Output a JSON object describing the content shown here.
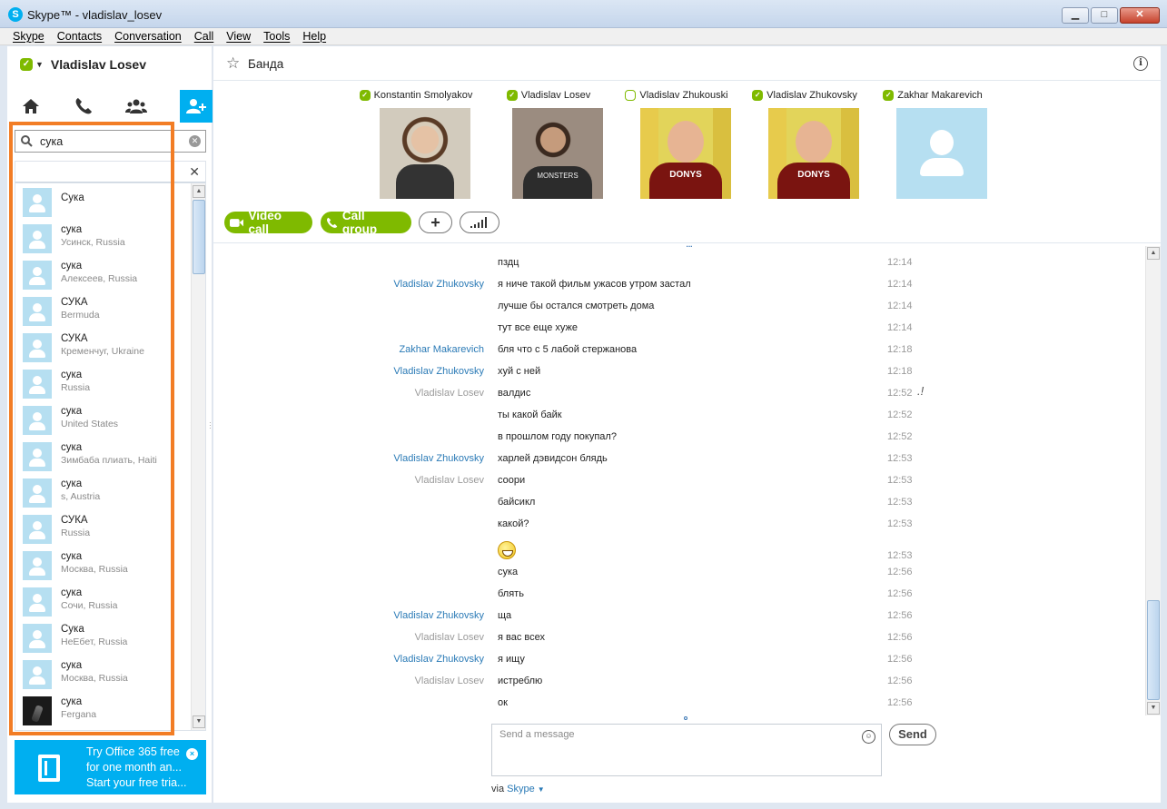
{
  "window": {
    "title": "Skype™ - vladislav_losev",
    "app_icon": "S",
    "minimize": "▁",
    "maximize": "□",
    "close": "✕"
  },
  "menu": [
    "Skype",
    "Contacts",
    "Conversation",
    "Call",
    "View",
    "Tools",
    "Help"
  ],
  "profile": {
    "name": "Vladislav Losev",
    "status_icon": "online-check-icon"
  },
  "nav_tabs": [
    "home-icon",
    "call-icon",
    "contacts-icon",
    "add-contact-icon"
  ],
  "search": {
    "value": "сука",
    "clear_icon": "clear-icon"
  },
  "results_header": {
    "close": "✕"
  },
  "results": [
    {
      "name": "Сука",
      "location": ""
    },
    {
      "name": "сука",
      "location": "Усинск, Russia"
    },
    {
      "name": "сука",
      "location": "Алексеев, Russia"
    },
    {
      "name": "СУКА",
      "location": "Bermuda"
    },
    {
      "name": "СУКА",
      "location": "Кременчуг, Ukraine"
    },
    {
      "name": "сука",
      "location": "Russia"
    },
    {
      "name": "сука",
      "location": "United States"
    },
    {
      "name": "сука",
      "location": "Зимбаба плиать, Haiti"
    },
    {
      "name": "сука",
      "location": "s, Austria"
    },
    {
      "name": "СУКА",
      "location": "Russia"
    },
    {
      "name": "сука",
      "location": "Москва, Russia"
    },
    {
      "name": "сука",
      "location": "Сочи, Russia"
    },
    {
      "name": "Сука",
      "location": "НеЕбет, Russia"
    },
    {
      "name": "сука",
      "location": "Москва, Russia"
    },
    {
      "name": "сука",
      "location": "Fergana",
      "photo": true
    }
  ],
  "promo": {
    "line1": "Try Office 365 free",
    "line2": "for one month an...",
    "line3": "Start your free tria...",
    "close": "×"
  },
  "conversation": {
    "title": "Банда",
    "info": "i",
    "participants": [
      {
        "name": "Konstantin Smolyakov",
        "status": "online"
      },
      {
        "name": "Vladislav  Losev",
        "status": "online"
      },
      {
        "name": "Vladislav Zhukouski",
        "status": "away"
      },
      {
        "name": "Vladislav Zhukovsky",
        "status": "online"
      },
      {
        "name": "Zakhar Makarevich",
        "status": "online"
      }
    ],
    "buttons": {
      "video": "Video call",
      "call": "Call group",
      "add": "+",
      "quality": "signal-icon"
    },
    "more": "...",
    "messages": [
      {
        "sender": "",
        "text": "пздц",
        "time": "12:14"
      },
      {
        "sender": "Vladislav Zhukovsky",
        "color": "blue",
        "text": "я ниче такой фильм ужасов утром застал",
        "time": "12:14"
      },
      {
        "sender": "",
        "text": "лучше бы остался смотреть дома",
        "time": "12:14"
      },
      {
        "sender": "",
        "text": "тут все еще хуже",
        "time": "12:14"
      },
      {
        "sender": "Zakhar Makarevich",
        "color": "blue",
        "text": "бля что с 5 лабой стержанова",
        "time": "12:18"
      },
      {
        "sender": "Vladislav Zhukovsky",
        "color": "blue",
        "text": "хуй с ней",
        "time": "12:18"
      },
      {
        "sender": "Vladislav Losev",
        "color": "grey",
        "text": "валдис",
        "time": "12:52",
        "mark": ".!"
      },
      {
        "sender": "",
        "text": "ты какой байк",
        "time": "12:52"
      },
      {
        "sender": "",
        "text": "в прошлом году покупал?",
        "time": "12:52"
      },
      {
        "sender": "Vladislav Zhukovsky",
        "color": "blue",
        "text": "харлей дэвидсон блядь",
        "time": "12:53"
      },
      {
        "sender": "Vladislav Losev",
        "color": "grey",
        "text": "соори",
        "time": "12:53"
      },
      {
        "sender": "",
        "text": "байсикл",
        "time": "12:53"
      },
      {
        "sender": "",
        "text": "какой?",
        "time": "12:53"
      },
      {
        "sender": "",
        "text": "",
        "emoticon": "laugh-emoticon",
        "time": "12:53"
      },
      {
        "sender": "",
        "text": "сука",
        "time": "12:56"
      },
      {
        "sender": "",
        "text": "блять",
        "time": "12:56"
      },
      {
        "sender": "Vladislav Zhukovsky",
        "color": "blue",
        "text": "ща",
        "time": "12:56"
      },
      {
        "sender": "Vladislav Losev",
        "color": "grey",
        "text": "я вас всех",
        "time": "12:56"
      },
      {
        "sender": "Vladislav Zhukovsky",
        "color": "blue",
        "text": "я ищу",
        "time": "12:56"
      },
      {
        "sender": "Vladislav Losev",
        "color": "grey",
        "text": "истреблю",
        "time": "12:56"
      },
      {
        "sender": "",
        "text": "ок",
        "time": "12:56"
      }
    ],
    "compose": {
      "placeholder": "Send a message",
      "send": "Send",
      "via": "via",
      "via_service": "Skype",
      "via_caret": "▼"
    }
  },
  "colors": {
    "skype_blue": "#00aff0",
    "online_green": "#7fba00",
    "highlight_orange": "#f27d25",
    "sender_blue": "#2a7ab6"
  }
}
